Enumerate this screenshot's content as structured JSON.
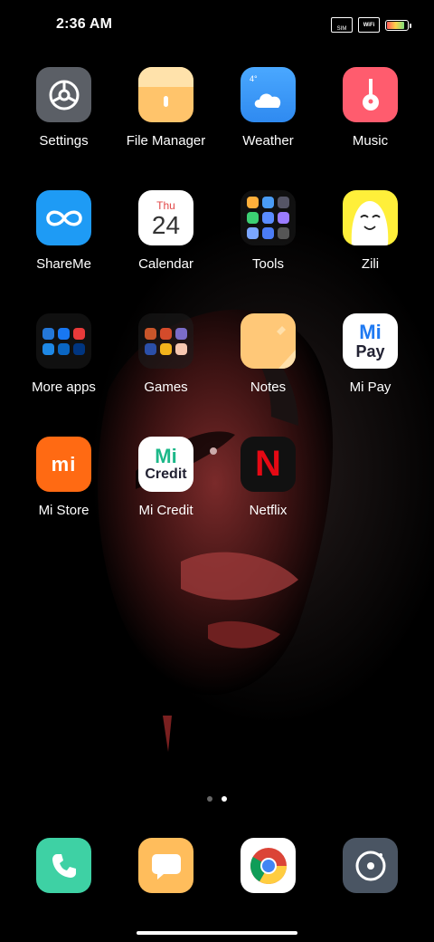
{
  "status_bar": {
    "time": "2:36 AM",
    "signal_text": "SIM",
    "wifi_text": "WiFi"
  },
  "apps": [
    {
      "label": "Settings"
    },
    {
      "label": "File Manager"
    },
    {
      "label": "Weather",
      "icon_text": "4°"
    },
    {
      "label": "Music"
    },
    {
      "label": "ShareMe"
    },
    {
      "label": "Calendar",
      "day": "Thu",
      "date": "24"
    },
    {
      "label": "Tools"
    },
    {
      "label": "Zili"
    },
    {
      "label": "More apps"
    },
    {
      "label": "Games"
    },
    {
      "label": "Notes"
    },
    {
      "label": "Mi Pay",
      "icon_top": "Mi",
      "icon_bottom": "Pay"
    },
    {
      "label": "Mi Store",
      "icon_text": "mi"
    },
    {
      "label": "Mi Credit",
      "icon_top": "Mi",
      "icon_bottom": "Credit"
    },
    {
      "label": "Netflix",
      "icon_text": "N"
    }
  ],
  "page_indicator": {
    "count": 2,
    "active": 2
  },
  "dock": [
    {
      "name": "Phone"
    },
    {
      "name": "Messages"
    },
    {
      "name": "Chrome"
    },
    {
      "name": "Camera"
    }
  ]
}
